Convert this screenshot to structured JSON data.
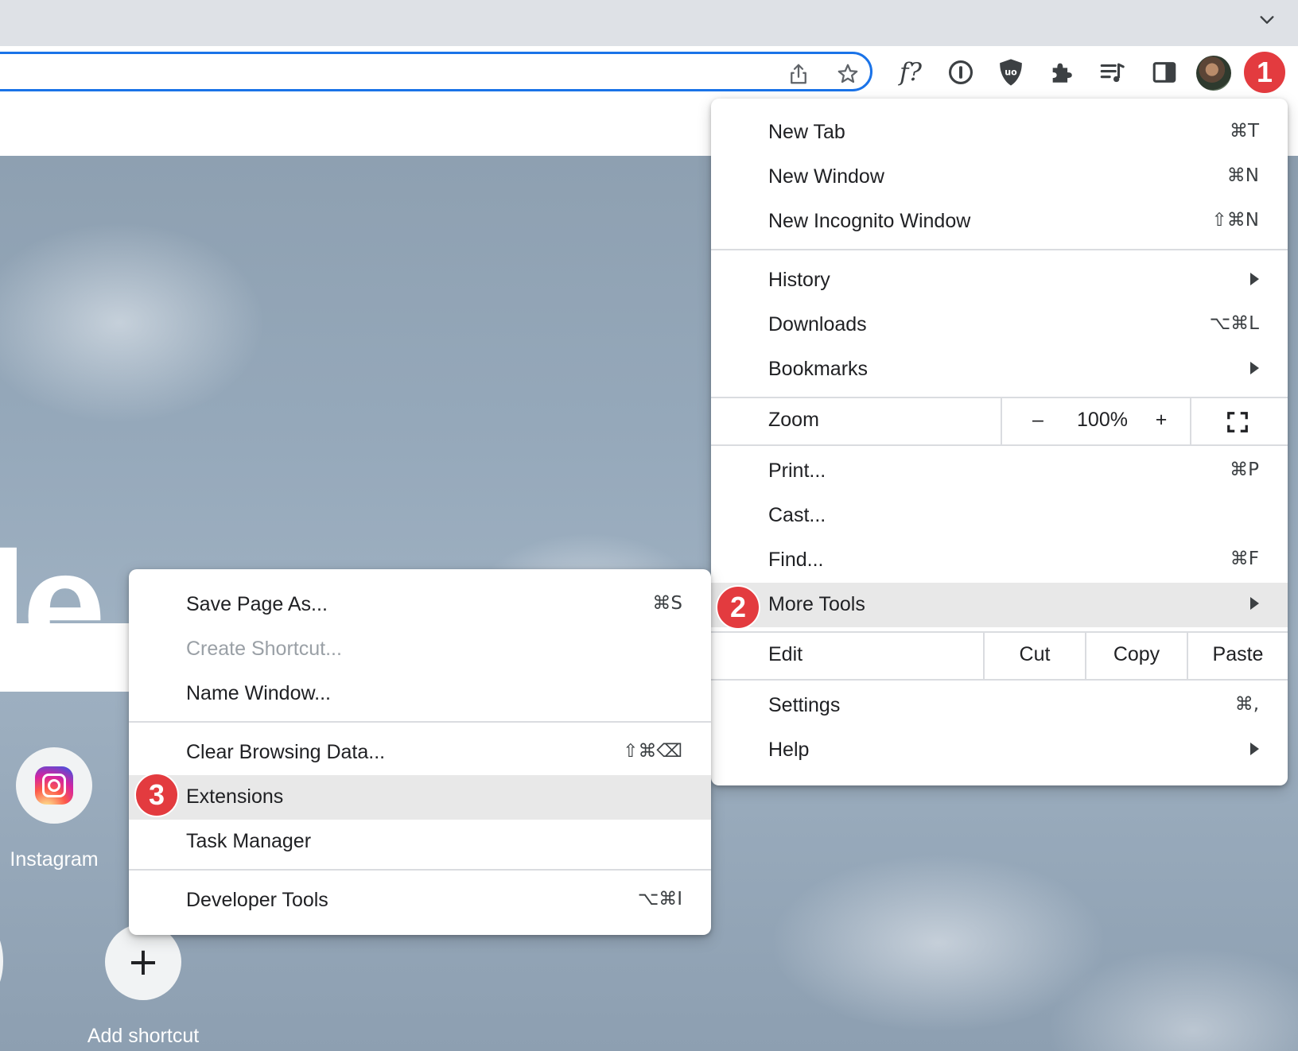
{
  "browser": {
    "tabstrip_chevron_icon": "chevron-down-icon",
    "toolbar_icons": [
      "share-icon",
      "bookmark-star-icon",
      "fx-extension-icon",
      "onepassword-icon",
      "ublock-origin-icon",
      "extensions-puzzle-icon",
      "reading-list-icon",
      "side-panel-icon",
      "profile-avatar"
    ],
    "fx_label": "f?",
    "accent_color": "#1a73e8"
  },
  "ntp": {
    "logo_fragment": "le",
    "shortcuts": [
      {
        "label": "Instagram",
        "icon": "instagram-icon"
      },
      {
        "label": "Add shortcut",
        "icon": "plus-icon",
        "glyph": "+"
      }
    ]
  },
  "main_menu": {
    "items": {
      "new_tab": {
        "label": "New Tab",
        "shortcut": "⌘T"
      },
      "new_window": {
        "label": "New Window",
        "shortcut": "⌘N"
      },
      "new_incognito": {
        "label": "New Incognito Window",
        "shortcut": "⇧⌘N"
      },
      "history": {
        "label": "History"
      },
      "downloads": {
        "label": "Downloads",
        "shortcut": "⌥⌘L"
      },
      "bookmarks": {
        "label": "Bookmarks"
      },
      "print": {
        "label": "Print...",
        "shortcut": "⌘P"
      },
      "cast": {
        "label": "Cast..."
      },
      "find": {
        "label": "Find...",
        "shortcut": "⌘F"
      },
      "more_tools": {
        "label": "More Tools"
      },
      "settings": {
        "label": "Settings",
        "shortcut": "⌘,"
      },
      "help": {
        "label": "Help"
      }
    },
    "zoom": {
      "label": "Zoom",
      "minus": "–",
      "value": "100%",
      "plus": "+"
    },
    "edit": {
      "label": "Edit",
      "cut": "Cut",
      "copy": "Copy",
      "paste": "Paste"
    }
  },
  "more_tools_menu": {
    "items": {
      "save_page": {
        "label": "Save Page As...",
        "shortcut": "⌘S"
      },
      "create_shortcut": {
        "label": "Create Shortcut...",
        "disabled": true
      },
      "name_window": {
        "label": "Name Window..."
      },
      "clear_browsing": {
        "label": "Clear Browsing Data...",
        "shortcut": "⇧⌘⌫"
      },
      "extensions": {
        "label": "Extensions"
      },
      "task_manager": {
        "label": "Task Manager"
      },
      "developer_tools": {
        "label": "Developer Tools",
        "shortcut": "⌥⌘I"
      }
    }
  },
  "step_badges": [
    "1",
    "2",
    "3"
  ],
  "badge_color": "#e33b3f"
}
